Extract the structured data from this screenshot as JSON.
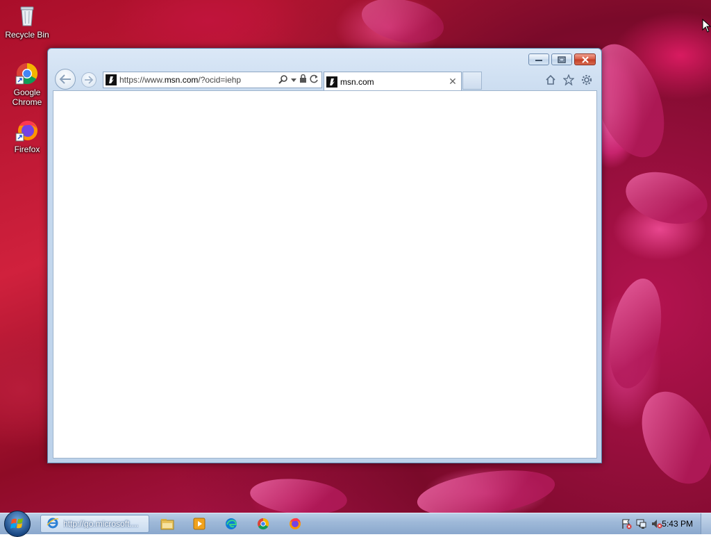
{
  "desktop": {
    "icons": [
      {
        "label": "Recycle Bin",
        "icon": "recycle-bin-icon"
      },
      {
        "label": "Google Chrome",
        "icon": "chrome-icon"
      },
      {
        "label": "Firefox",
        "icon": "firefox-icon"
      }
    ]
  },
  "browser": {
    "address": {
      "prefix": "https://www.",
      "domain": "msn.com",
      "suffix": "/?ocid=iehp"
    },
    "tab": {
      "title": "msn.com"
    },
    "caption_buttons": [
      "minimize",
      "restore",
      "close"
    ],
    "toolbar_icons": [
      "home-icon",
      "favorites-star-icon",
      "settings-gear-icon"
    ]
  },
  "taskbar": {
    "active_task": "http://go.microsoft....",
    "pinned": [
      "file-explorer-icon",
      "media-player-icon",
      "edge-icon",
      "chrome-icon",
      "firefox-icon"
    ],
    "tray_icons": [
      "action-center-flag-icon",
      "network-icon",
      "volume-muted-icon"
    ],
    "clock": "5:43 PM"
  },
  "colors": {
    "window_frame": "#c9dbef",
    "close_button": "#c23c24",
    "taskbar": "#9fb9d9"
  }
}
